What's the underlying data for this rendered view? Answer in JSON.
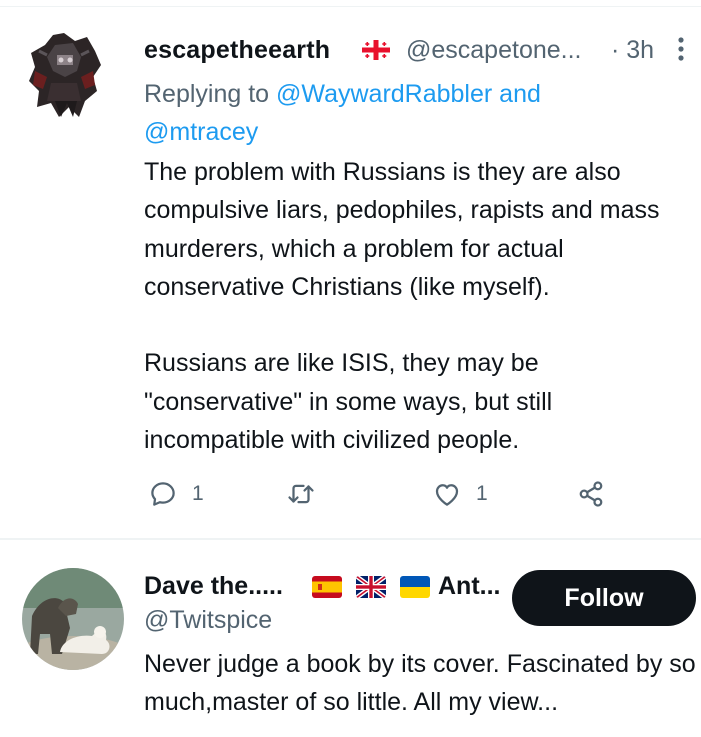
{
  "tweet": {
    "display_name": "escapetheearth",
    "handle": "@escapetone...",
    "time": "· 3h",
    "reply_prefix": "Replying to",
    "reply_user1": "@WaywardRabbler",
    "reply_and": "and",
    "reply_user2": "@mtracey",
    "text": "The problem with Russians is they are also compulsive liars, pedophiles, rapists and mass murderers, which a problem for actual conservative Christians (like myself).\n\nRussians are like ISIS, they may be \"conservative\" in some ways, but still incompatible with civilized people.",
    "reply_count": "1",
    "like_count": "1",
    "icons": {
      "flag": "georgia-flag-icon",
      "more": "more-options-icon",
      "reply": "reply-icon",
      "retweet": "retweet-icon",
      "like": "heart-icon",
      "share": "share-icon"
    }
  },
  "suggestion": {
    "display_name_part1": "Dave the.....",
    "display_name_part2": "Ant...",
    "handle": "@Twitspice",
    "bio": "Never judge a book by its cover. Fascinated by so much,master of so little. All my view...",
    "follow_label": "Follow"
  },
  "colors": {
    "text": "#0f1419",
    "secondary": "#536471",
    "link": "#1d9bf0",
    "follow_bg": "#0f1419",
    "divider": "#eff3f4"
  }
}
